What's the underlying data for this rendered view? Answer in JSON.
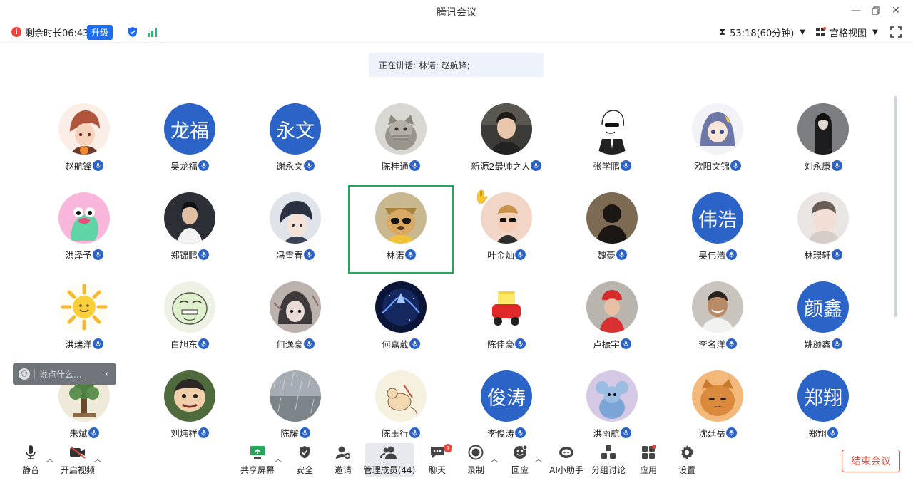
{
  "window": {
    "title": "腾讯会议"
  },
  "status": {
    "remaining": "剩余时长06:43",
    "upgrade": "升级",
    "timer": "53:18(60分钟)",
    "view": "宫格视图"
  },
  "speaking": "正在讲话: 林诺; 赵航锋;",
  "participants": [
    {
      "name": "赵航锋",
      "avatar": "anime-boy",
      "host": true
    },
    {
      "name": "吴龙福",
      "text": "龙福"
    },
    {
      "name": "谢永文",
      "text": "永文"
    },
    {
      "name": "陈桂通",
      "avatar": "cat"
    },
    {
      "name": "新源2最帅之人",
      "avatar": "photo-man"
    },
    {
      "name": "张学鹏",
      "avatar": "sketch-man"
    },
    {
      "name": "欧阳文锦",
      "avatar": "anime-girl"
    },
    {
      "name": "刘永康",
      "avatar": "dark-figure"
    },
    {
      "name": "洪泽予",
      "avatar": "pink-monster"
    },
    {
      "name": "郑锦鹏",
      "avatar": "photo-boy"
    },
    {
      "name": "冯雪春",
      "avatar": "anime-face"
    },
    {
      "name": "林诺",
      "avatar": "dog-glasses",
      "active": true
    },
    {
      "name": "叶金灿",
      "avatar": "kid-glasses",
      "hand": true
    },
    {
      "name": "魏豪",
      "avatar": "silhouette"
    },
    {
      "name": "吴伟浩",
      "text": "伟浩"
    },
    {
      "name": "林璟轩",
      "avatar": "photo-pale"
    },
    {
      "name": "洪瑞洋",
      "avatar": "sun"
    },
    {
      "name": "白旭东",
      "avatar": "meme-face"
    },
    {
      "name": "何逸豪",
      "avatar": "anime-gray"
    },
    {
      "name": "何嘉葳",
      "avatar": "galaxy"
    },
    {
      "name": "陈佳豪",
      "avatar": "toy-car"
    },
    {
      "name": "卢振宇",
      "avatar": "red-hat"
    },
    {
      "name": "李名洋",
      "avatar": "smile-man"
    },
    {
      "name": "姚颜鑫",
      "text": "颜鑫"
    },
    {
      "name": "朱斌",
      "avatar": "tree"
    },
    {
      "name": "刘炜祥",
      "avatar": "cartoon-face"
    },
    {
      "name": "陈耀",
      "avatar": "rain"
    },
    {
      "name": "陈玉行",
      "avatar": "mouse-sketch"
    },
    {
      "name": "李俊涛",
      "text": "俊涛"
    },
    {
      "name": "洪雨航",
      "avatar": "jerry"
    },
    {
      "name": "沈廷岳",
      "avatar": "orange-cat"
    },
    {
      "name": "郑翔",
      "text": "郑翔"
    }
  ],
  "chat": {
    "placeholder": "说点什么..."
  },
  "toolbar": {
    "mute": "静音",
    "video": "开启视频",
    "share": "共享屏幕",
    "security": "安全",
    "invite": "邀请",
    "members": "管理成员(44)",
    "chat": "聊天",
    "chat_badge": "1",
    "record": "录制",
    "reaction": "回应",
    "ai": "AI小助手",
    "breakout": "分组讨论",
    "apps": "应用",
    "settings": "设置",
    "end": "结束会议"
  },
  "colors": {
    "accent": "#2b63c6",
    "active_border": "#26a65b",
    "end": "#e0483c"
  }
}
